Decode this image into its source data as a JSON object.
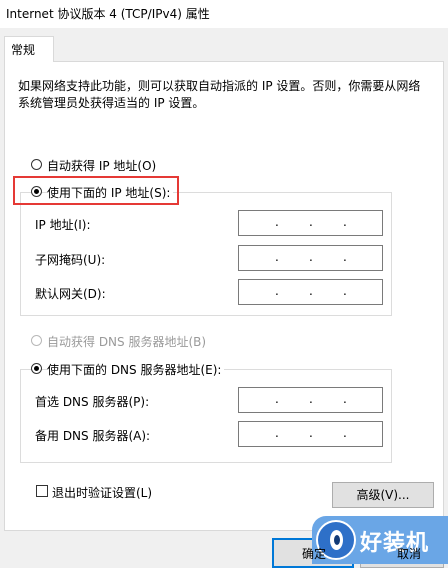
{
  "window": {
    "title": "Internet 协议版本 4 (TCP/IPv4) 属性"
  },
  "tabs": [
    {
      "label": "常规",
      "selected": true
    }
  ],
  "description": "如果网络支持此功能，则可以获取自动指派的 IP 设置。否则，你需要从网络系统管理员处获得适当的 IP 设置。",
  "ip_section": {
    "auto_label": "自动获得 IP 地址(O)",
    "manual_label": "使用下面的 IP 地址(S):",
    "selected": "manual",
    "fields": [
      {
        "label": "IP 地址(I):",
        "value": ". . ."
      },
      {
        "label": "子网掩码(U):",
        "value": ". . ."
      },
      {
        "label": "默认网关(D):",
        "value": ". . ."
      }
    ]
  },
  "dns_section": {
    "auto_label": "自动获得 DNS 服务器地址(B)",
    "manual_label": "使用下面的 DNS 服务器地址(E):",
    "auto_disabled": true,
    "selected": "manual",
    "fields": [
      {
        "label": "首选 DNS 服务器(P):",
        "value": ". . ."
      },
      {
        "label": "备用 DNS 服务器(A):",
        "value": ". . ."
      }
    ]
  },
  "validate_on_exit": {
    "label": "退出时验证设置(L)",
    "checked": false
  },
  "buttons": {
    "advanced": "高级(V)...",
    "ok": "确定",
    "cancel": "取消"
  },
  "watermark": {
    "text": "好装机"
  },
  "colors": {
    "highlight": "#e53935",
    "primary_border": "#0078d7",
    "watermark_bg": "#6aa6e6"
  }
}
